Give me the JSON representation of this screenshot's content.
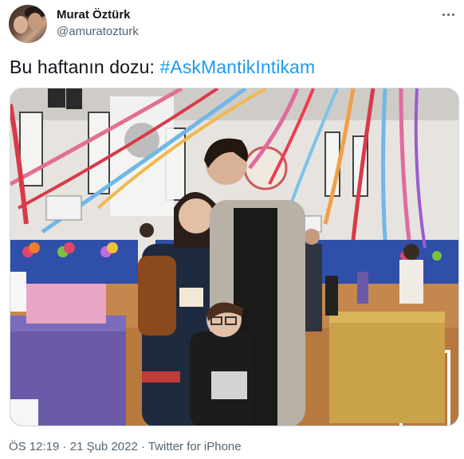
{
  "author": {
    "display_name": "Murat Öztürk",
    "handle": "@amuratozturk",
    "avatar_icon": "profile-photo"
  },
  "more_icon": "ellipsis-icon",
  "tweet": {
    "text_prefix": "Bu haftanın dozu: ",
    "hashtag": "#AskMantikIntikam"
  },
  "media": {
    "description_icon": "photo"
  },
  "meta": {
    "time": "ÖS 12:19",
    "sep1": " · ",
    "date": "21 Şub 2022",
    "sep2": " · ",
    "source": "Twitter for iPhone"
  },
  "colors": {
    "link": "#1d9bf0",
    "text": "#0f1419",
    "secondary": "#536471"
  }
}
